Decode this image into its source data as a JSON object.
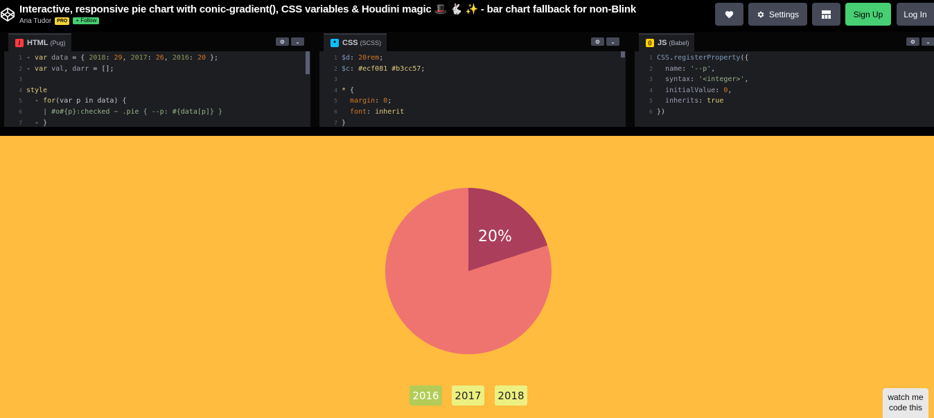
{
  "header": {
    "title": "Interactive, responsive pie chart with conic-gradient(), CSS variables & Houdini magic 🎩 🐇 ✨ - bar chart fallback for non-Blink",
    "author": "Ana Tudor",
    "pro_badge": "PRO",
    "follow_label": "+ Follow",
    "settings_label": "Settings",
    "signup_label": "Sign Up",
    "login_label": "Log In",
    "icons": [
      "codepen-logo-icon",
      "heart-icon",
      "gear-icon",
      "layout-grid-icon"
    ]
  },
  "editors": {
    "html": {
      "name": "HTML",
      "preprocessor": "(Pug)",
      "badge_color": "#ff3c41",
      "line_numbers": [
        "1",
        "2",
        "3",
        "4",
        "5",
        "6",
        "7"
      ]
    },
    "css": {
      "name": "CSS",
      "preprocessor": "(SCSS)",
      "badge_color": "#0ebeff",
      "line_numbers": [
        "1",
        "2",
        "3",
        "4",
        "5",
        "6",
        "7"
      ]
    },
    "js": {
      "name": "JS",
      "preprocessor": "(Babel)",
      "badge_color": "#fcd000",
      "line_numbers": [
        "1",
        "2",
        "3",
        "4",
        "5",
        "6"
      ]
    }
  },
  "result": {
    "background": "#ffbc3f",
    "pie": {
      "selected_percent": 20,
      "label": "20%",
      "colors": {
        "selected": "#ab3e5b",
        "rest": "#ef746f"
      }
    },
    "buttons": [
      {
        "label": "2016",
        "selected": true
      },
      {
        "label": "2017",
        "selected": false
      },
      {
        "label": "2018",
        "selected": false
      }
    ],
    "button_colors": {
      "selected": "#b3cc57",
      "normal": "#ecf081"
    },
    "watch_label_1": "watch me",
    "watch_label_2": "code this"
  }
}
